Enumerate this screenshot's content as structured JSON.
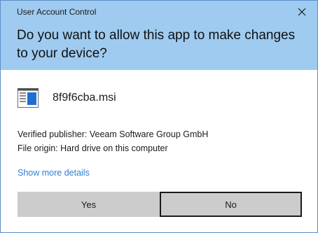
{
  "window": {
    "title": "User Account Control",
    "close_icon": "close-icon"
  },
  "prompt": {
    "question": "Do you want to allow this app to make changes to your device?"
  },
  "app": {
    "name": "8f9f6cba.msi",
    "icon": "installer-package-icon"
  },
  "info": {
    "publisher": "Verified publisher: Veeam Software Group GmbH",
    "origin": "File origin: Hard drive on this computer"
  },
  "details_link": "Show more details",
  "buttons": {
    "yes_label": "Yes",
    "no_label": "No"
  },
  "colors": {
    "header_bg": "#9fcbf0",
    "link": "#2f7fd6",
    "button_bg": "#cccccc",
    "focus_border": "#1a1a1a"
  }
}
